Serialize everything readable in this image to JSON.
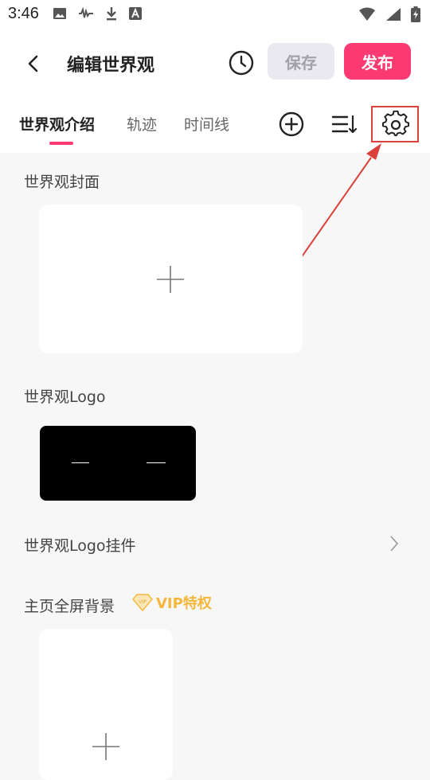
{
  "status_bar": {
    "time": "3:46",
    "icons_left": [
      "image-icon",
      "waveform-icon",
      "download-icon",
      "font-a-icon"
    ],
    "icons_right": [
      "wifi-icon",
      "signal-icon",
      "battery-charging-icon"
    ]
  },
  "header": {
    "title": "编辑世界观",
    "save_label": "保存",
    "publish_label": "发布"
  },
  "tabs": [
    {
      "label": "世界观介绍",
      "active": true
    },
    {
      "label": "轨迹",
      "active": false
    },
    {
      "label": "时间线",
      "active": false
    }
  ],
  "toolbar_icons": [
    "add-circle-icon",
    "sort-icon",
    "gear-icon"
  ],
  "sections": {
    "cover": {
      "label": "世界观封面"
    },
    "logo": {
      "label": "世界观Logo"
    },
    "logo_pendant": {
      "label": "世界观Logo挂件"
    },
    "home_background": {
      "label": "主页全屏背景",
      "vip_label": "VIP特权"
    }
  },
  "colors": {
    "accent": "#fc3a72",
    "vip_gold": "#f4b73c",
    "highlight_red": "#d9413a"
  }
}
